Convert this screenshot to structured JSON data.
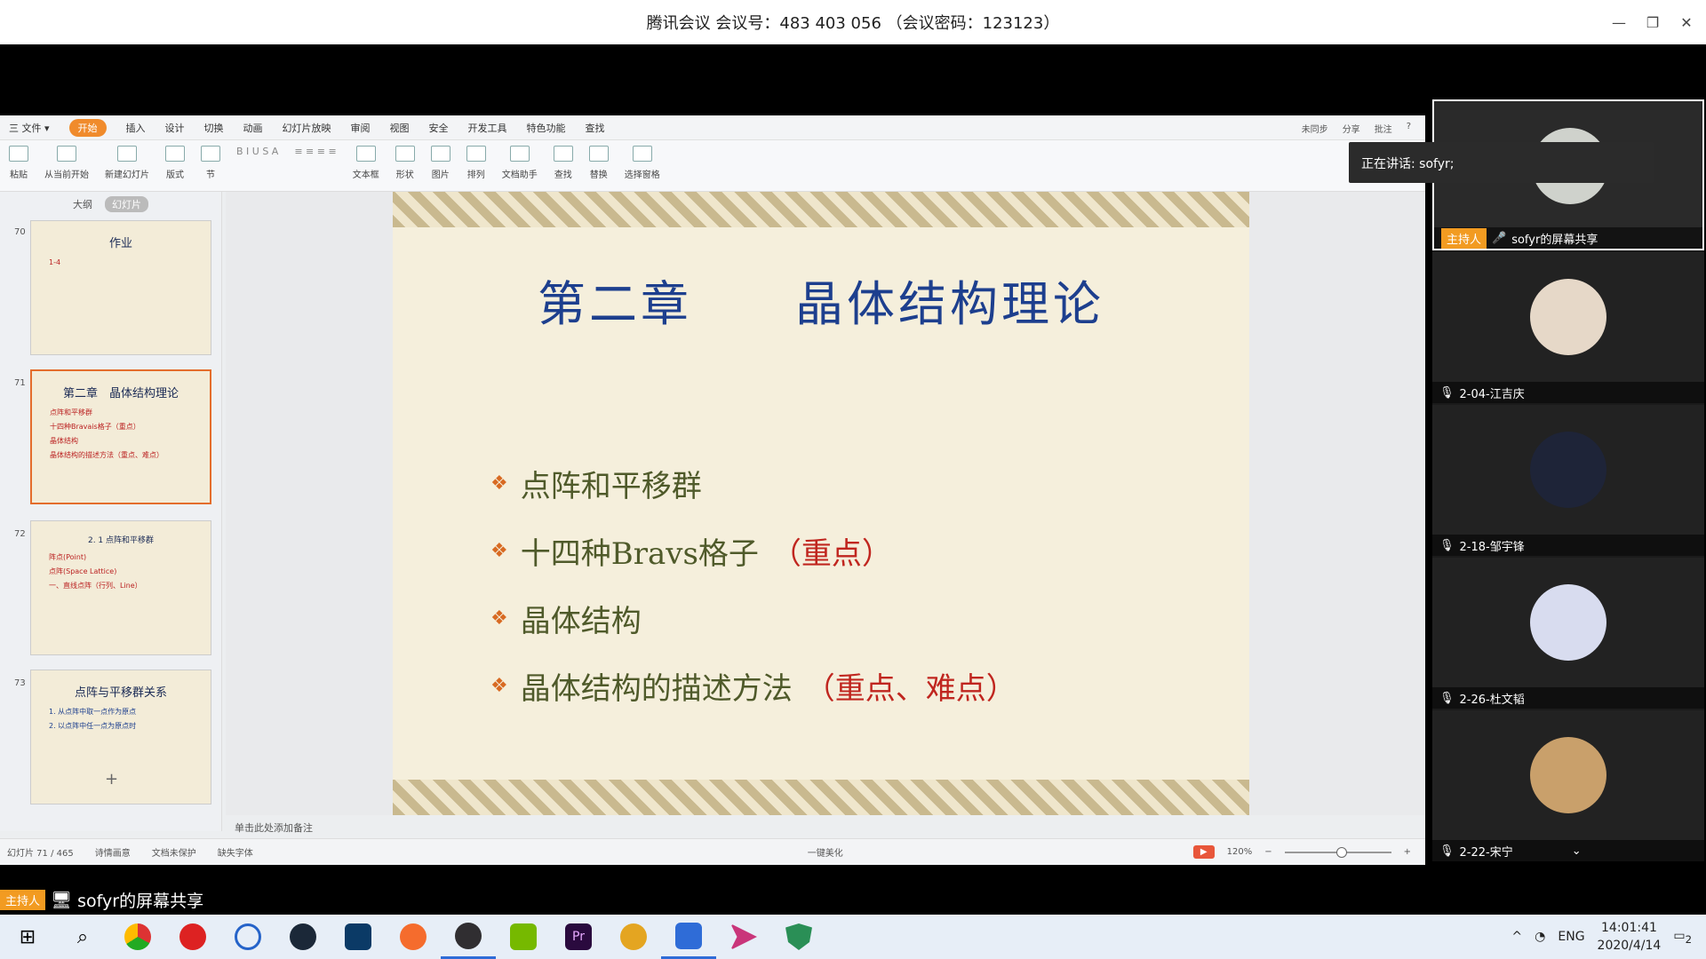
{
  "meeting": {
    "title": "腾讯会议 会议号：483 403 056 （会议密码：123123）"
  },
  "wps": {
    "menu": [
      "三 文件 ▾",
      "开始",
      "插入",
      "设计",
      "切换",
      "动画",
      "幻灯片放映",
      "审阅",
      "视图",
      "安全",
      "开发工具",
      "特色功能",
      "查找"
    ],
    "menu_active_index": 1,
    "menu_right": [
      "未同步",
      "分享",
      "批注",
      "?"
    ],
    "ribbon": [
      "粘贴",
      "从当前开始",
      "新建幻灯片",
      "版式",
      "节",
      "文本框",
      "形状",
      "图片",
      "排列",
      "文档助手",
      "查找",
      "替换",
      "选择窗格"
    ],
    "side_tabs": [
      "大纲",
      "幻灯片"
    ],
    "thumbs": [
      {
        "num": "70",
        "title": "作业",
        "lines": [
          "1-4"
        ]
      },
      {
        "num": "71",
        "title": "第二章　晶体结构理论",
        "lines": [
          "点阵和平移群",
          "十四种Bravais格子（重点）",
          "晶体结构",
          "晶体结构的描述方法（重点、难点）"
        ]
      },
      {
        "num": "72",
        "title": "2. 1 点阵和平移群",
        "lines": [
          "阵点(Point)",
          "点阵(Space Lattice)",
          "一、直线点阵（行列、Line）"
        ]
      },
      {
        "num": "73",
        "title": "点阵与平移群关系",
        "lines": [
          "1. 从点阵中取一点作为原点",
          "2. 以点阵中任一点为原点时"
        ]
      }
    ],
    "slide": {
      "title": "第二章　　晶体结构理论",
      "bullets": [
        {
          "text": "点阵和平移群",
          "hl": ""
        },
        {
          "text": "十四种Bravs格子",
          "hl": "（重点）"
        },
        {
          "text": "晶体结构",
          "hl": ""
        },
        {
          "text": "晶体结构的描述方法",
          "hl": "（重点、难点）"
        }
      ]
    },
    "notes": "单击此处添加备注",
    "status": {
      "slide": "幻灯片 71 / 465",
      "theme": "诗情画意",
      "protect": "文档未保护",
      "font": "缺失字体",
      "beautify": "一键美化",
      "zoom": "120%"
    }
  },
  "participants": [
    {
      "name": "sofyr的屏幕共享",
      "host": "主持人"
    },
    {
      "name": "2-04-江吉庆"
    },
    {
      "name": "2-18-邹宇锋"
    },
    {
      "name": "2-26-杜文韬"
    },
    {
      "name": "2-22-宋宁"
    }
  ],
  "speaking": "正在讲话: sofyr;",
  "presenter": {
    "host": "主持人",
    "name": "sofyr的屏幕共享"
  },
  "taskbar": {
    "lang": "ENG",
    "time": "14:01:41",
    "date": "2020/4/14",
    "notif": "2"
  }
}
